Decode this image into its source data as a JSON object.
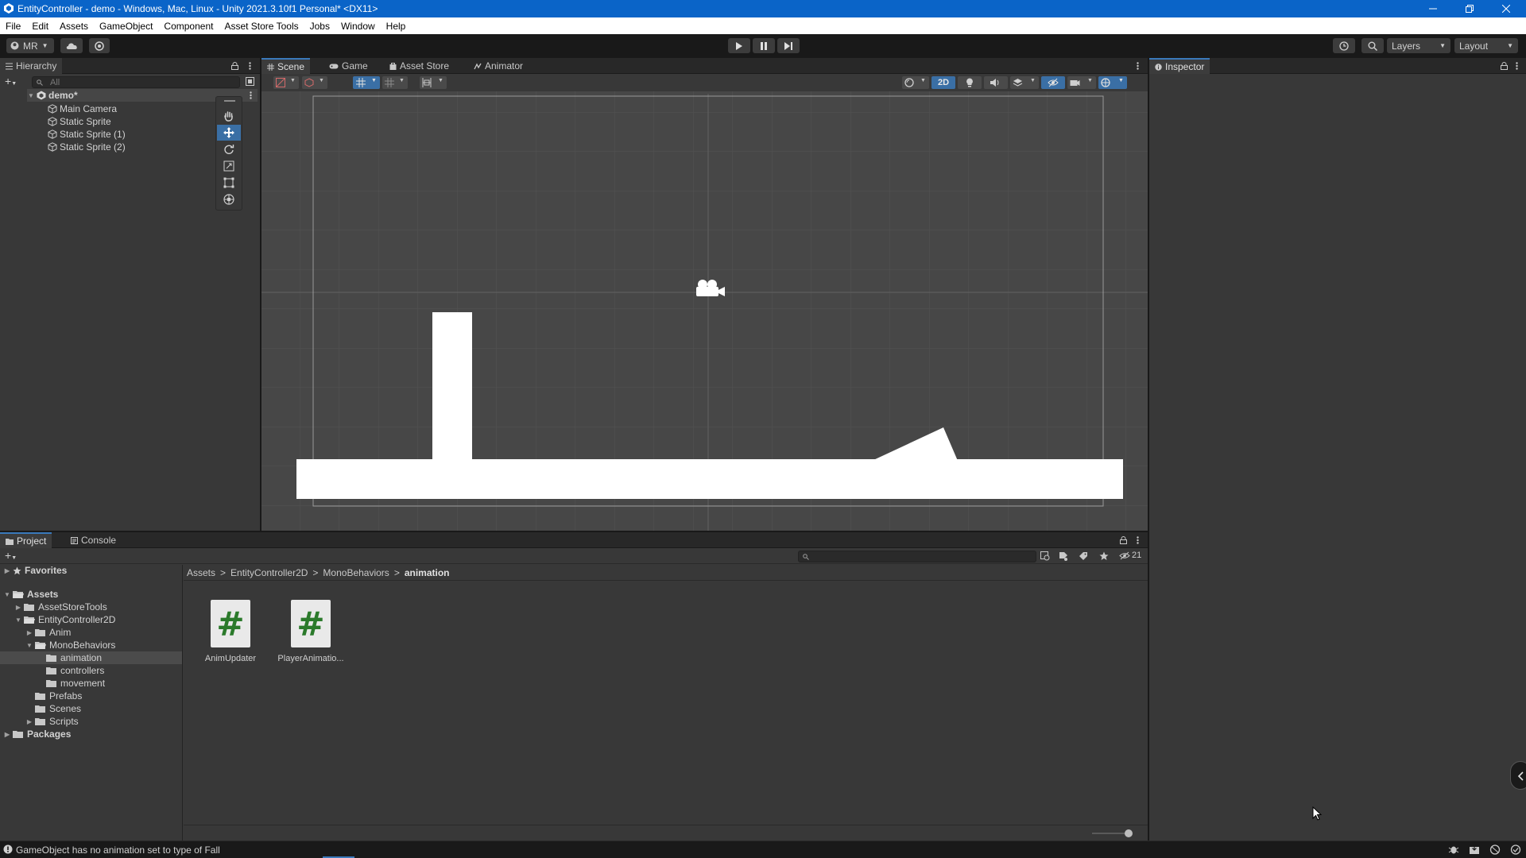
{
  "window": {
    "title": "EntityController - demo - Windows, Mac, Linux - Unity 2021.3.10f1 Personal* <DX11>"
  },
  "menu": [
    "File",
    "Edit",
    "Assets",
    "GameObject",
    "Component",
    "Asset Store Tools",
    "Jobs",
    "Window",
    "Help"
  ],
  "toolbar": {
    "account": "MR",
    "layers": "Layers",
    "layout": "Layout"
  },
  "hierarchy": {
    "tab": "Hierarchy",
    "search_placeholder": "All",
    "scene": "demo*",
    "items": [
      "Main Camera",
      "Static Sprite",
      "Static Sprite (1)",
      "Static Sprite (2)"
    ]
  },
  "scene_tabs": [
    "Scene",
    "Game",
    "Asset Store",
    "Animator"
  ],
  "scene_toolbar": {
    "mode_2d": "2D"
  },
  "inspector": {
    "tab": "Inspector"
  },
  "bottom_tabs": [
    "Project",
    "Console"
  ],
  "project": {
    "favorites": "Favorites",
    "tree": {
      "assets": "Assets",
      "asset_store_tools": "AssetStoreTools",
      "entity_controller": "EntityController2D",
      "anim": "Anim",
      "mono": "MonoBehaviors",
      "animation": "animation",
      "controllers": "controllers",
      "movement": "movement",
      "prefabs": "Prefabs",
      "scenes": "Scenes",
      "scripts": "Scripts",
      "packages": "Packages"
    },
    "breadcrumb": [
      "Assets",
      "EntityController2D",
      "MonoBehaviors",
      "animation"
    ],
    "hidden_count": "21",
    "files": [
      {
        "name": "AnimUpdater",
        "icon": "#"
      },
      {
        "name": "PlayerAnimatio...",
        "icon": "#"
      }
    ]
  },
  "status": {
    "message": "GameObject has no animation set to type of Fall"
  }
}
